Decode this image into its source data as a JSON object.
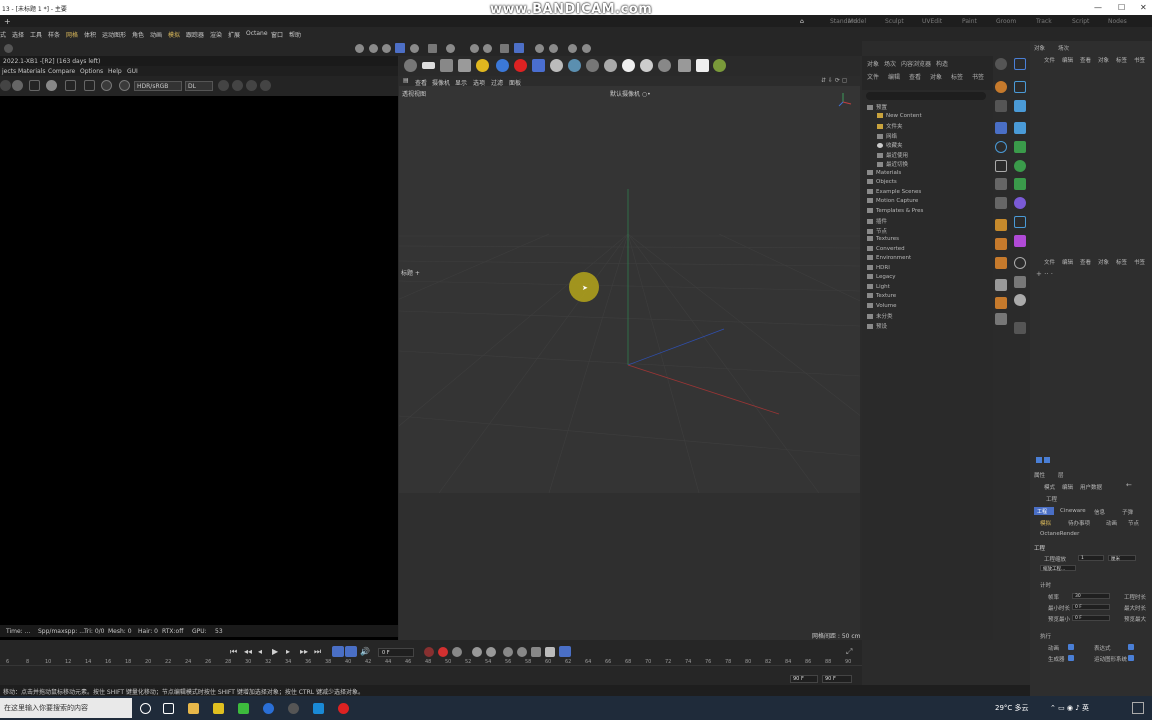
{
  "window": {
    "title": "13 - [未标题 1 *] - 主要",
    "watermark": "www.BANDICAM.com",
    "controls": [
      "—",
      "☐",
      "✕"
    ]
  },
  "layouts": [
    "Standard",
    "Model",
    "Sculpt",
    "UVEdit",
    "Paint",
    "Groom",
    "Track",
    "Script",
    "Nodes"
  ],
  "menu": [
    "式",
    "选择",
    "工具",
    "样条",
    "网格",
    "体积",
    "运动图形",
    "角色",
    "动画",
    "模拟",
    "跟踪器",
    "渲染",
    "扩展",
    "Octane",
    "窗口",
    "帮助"
  ],
  "octane": {
    "version": "2022.1-XB1 -[R2] (163 days left)",
    "menu": [
      "jects",
      "Materials",
      "Compare",
      "Options",
      "Help",
      "GUI"
    ],
    "mode": "HDR/sRGB",
    "channel": "DL",
    "status": {
      "time": "Time: ...",
      "spp": "Spp/maxspp: ...",
      "tri": "Tri: 0/0",
      "mesh": "Mesh: 0",
      "hair": "Hair: 0",
      "rtx": "RTX:off",
      "gpu": "GPU:",
      "gpu_val": "53"
    }
  },
  "viewport": {
    "label": "透视视图",
    "camera": "默认摄像机 ○•",
    "side_label": "标题 +",
    "grid": "网格间距 : 50 cm",
    "menu": [
      "查看",
      "摄像机",
      "显示",
      "选项",
      "过滤",
      "面板"
    ]
  },
  "timeline": {
    "frame": "0 F",
    "start": "90 F",
    "end": "90 F",
    "ticks": [
      "6",
      "8",
      "10",
      "12",
      "14",
      "16",
      "18",
      "20",
      "22",
      "24",
      "26",
      "28",
      "30",
      "32",
      "34",
      "36",
      "38",
      "40",
      "42",
      "44",
      "46",
      "48",
      "50",
      "52",
      "54",
      "56",
      "58",
      "60",
      "62",
      "64",
      "66",
      "68",
      "70",
      "72",
      "74",
      "76",
      "78",
      "80",
      "82",
      "84",
      "86",
      "88",
      "90"
    ]
  },
  "statusbar": "移动：点击并拖动鼠标移动元素。按住 SHIFT 键量化移动；节点编辑模式时按住 SHIFT 键增加选择对象；按住 CTRL 键减少选择对象。",
  "objpanel": {
    "tabs": [
      "对象",
      "场次",
      "内容浏览器",
      "构造"
    ],
    "subtabs": [
      "文件",
      "编辑",
      "查看",
      "对象",
      "标签",
      "书签"
    ],
    "tree": [
      {
        "label": "预置",
        "yellow": false
      },
      {
        "label": "New Content",
        "yellow": true
      },
      {
        "label": "文件夹",
        "yellow": true
      },
      {
        "label": "网络",
        "yellow": false
      },
      {
        "label": "收藏夹",
        "yellow": false
      },
      {
        "label": "最近使用",
        "yellow": false
      },
      {
        "label": "最近切换",
        "yellow": false
      },
      {
        "label": "Materials",
        "yellow": false
      },
      {
        "label": "Objects",
        "yellow": false
      },
      {
        "label": "Example Scenes",
        "yellow": false
      },
      {
        "label": "Motion Capture",
        "yellow": false
      },
      {
        "label": "Templates & Pres",
        "yellow": false
      },
      {
        "label": "插件",
        "yellow": false
      },
      {
        "label": "节点",
        "yellow": false
      },
      {
        "label": "Textures",
        "yellow": false
      },
      {
        "label": "Converted",
        "yellow": false
      },
      {
        "label": "Environment",
        "yellow": false
      },
      {
        "label": "HDRI",
        "yellow": false
      },
      {
        "label": "Legacy",
        "yellow": false
      },
      {
        "label": "Light",
        "yellow": false
      },
      {
        "label": "Texture",
        "yellow": false
      },
      {
        "label": "Volume",
        "yellow": false
      },
      {
        "label": "未分类",
        "yellow": false
      },
      {
        "label": "预设",
        "yellow": false
      }
    ]
  },
  "rightpanel": {
    "tabs": [
      "对象",
      "场次"
    ],
    "menu": [
      "文件",
      "编辑",
      "查看",
      "对象",
      "标签",
      "书签"
    ],
    "menu2": [
      "文件",
      "编辑",
      "查看",
      "对象",
      "标签",
      "书签"
    ],
    "attr_tabs": [
      "属性",
      "层"
    ],
    "attr_menu": [
      "模式",
      "编辑",
      "用户数据"
    ],
    "project": "工程",
    "proj_tabs": [
      "工程",
      "Cineware",
      "信息",
      "子弹"
    ],
    "proj_tabs2": [
      "模拟",
      "待办事项",
      "动画",
      "节点"
    ],
    "octane_render": "OctaneRender",
    "section": "工程",
    "scale_label": "工程缩放",
    "scale_value": "1",
    "scale_unit": "厘米",
    "reset_btn": "缩放工程...",
    "timing": "计时",
    "fps_label": "帧率",
    "fps_value": "30",
    "fps_label2": "工程时长",
    "min_label": "最小时长",
    "min_value": "0 F",
    "max_label": "最大时长",
    "pmin_label": "预览最小",
    "pmin_value": "0 F",
    "pmax_label": "预览最大",
    "exec": "执行",
    "anim_label": "动画",
    "expr_label": "表达式",
    "gen_label": "生成器",
    "deform_label": "运动图形系统"
  },
  "taskbar": {
    "search": "在这里输入你要搜索的内容",
    "weather": "29°C 多云"
  }
}
